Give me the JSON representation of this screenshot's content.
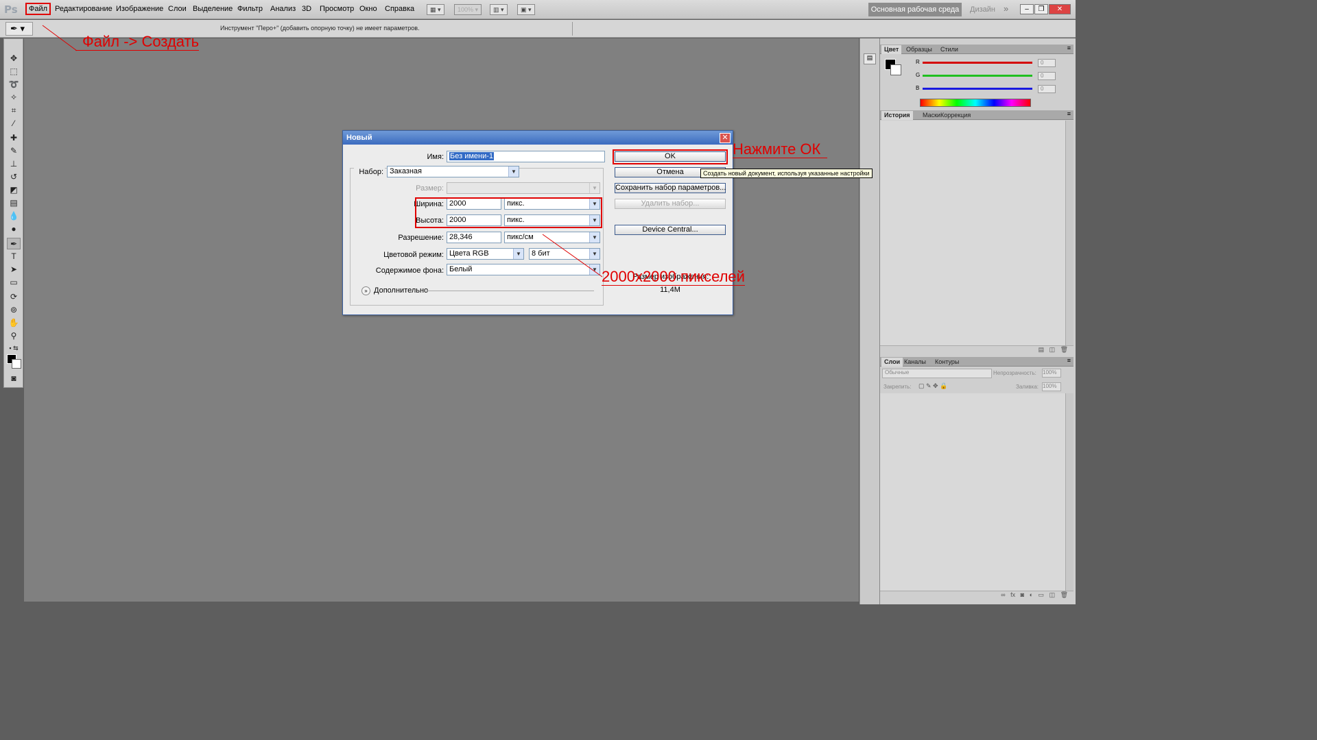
{
  "app": {
    "logo": "Ps",
    "menu": [
      "Файл",
      "Редактирование",
      "Изображение",
      "Слои",
      "Выделение",
      "Фильтр",
      "Анализ",
      "3D",
      "Просмотр",
      "Окно",
      "Справка"
    ],
    "zoom": "100%",
    "workspace": "Основная рабочая среда",
    "design": "Дизайн",
    "more": "»"
  },
  "options_bar": {
    "tool_hint": "Инструмент \"Перо+\" (добавить опорную точку) не имеет параметров."
  },
  "dialog": {
    "title": "Новый",
    "name_label": "Имя:",
    "name_value": "Без имени-1",
    "preset_label": "Набор:",
    "preset_value": "Заказная",
    "size_label": "Размер:",
    "width_label": "Ширина:",
    "width_value": "2000",
    "width_unit": "пикс.",
    "height_label": "Высота:",
    "height_value": "2000",
    "height_unit": "пикс.",
    "resolution_label": "Разрешение:",
    "resolution_value": "28,346",
    "resolution_unit": "пикс/см",
    "color_mode_label": "Цветовой режим:",
    "color_mode_value": "Цвета RGB",
    "bit_depth": "8 бит",
    "background_label": "Содержимое фона:",
    "background_value": "Белый",
    "advanced_label": "Дополнительно",
    "image_size_label": "Размер изображения:",
    "image_size_value": "11,4M",
    "buttons": {
      "ok": "OK",
      "cancel": "Отмена",
      "save_preset": "Сохранить набор параметров...",
      "delete_preset": "Удалить набор...",
      "device_central": "Device Central..."
    },
    "tooltip": "Создать новый документ, используя указанные настройки"
  },
  "panels": {
    "color_tabs": [
      "Цвет",
      "Образцы",
      "Стили"
    ],
    "channels": [
      {
        "label": "R",
        "value": "0",
        "color": "#d40000"
      },
      {
        "label": "G",
        "value": "0",
        "color": "#1fbf1f"
      },
      {
        "label": "B",
        "value": "0",
        "color": "#1a1adf"
      }
    ],
    "history_tabs": [
      "История",
      "Маски",
      "Коррекция"
    ],
    "layers_tabs": [
      "Слои",
      "Каналы",
      "Контуры"
    ],
    "blend_mode": "Обычные",
    "opacity_label": "Непрозрачность:",
    "opacity_value": "100%",
    "lock_label": "Закрепить:",
    "fill_label": "Заливка:",
    "fill_value": "100%"
  },
  "annotations": {
    "file_create": "Файл -> Создать",
    "press_ok": "Нажмите ОК",
    "size_note": "2000х2000 пикселей",
    "color": "#e00000"
  }
}
